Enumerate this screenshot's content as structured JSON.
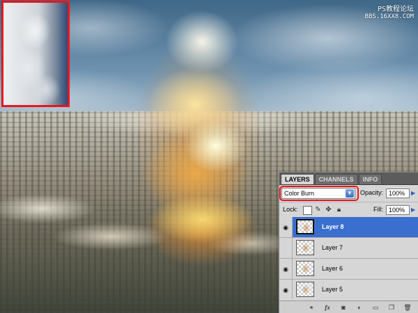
{
  "watermark": {
    "line1": "PS教程论坛",
    "line2": "BBS.16XX8.COM"
  },
  "colors": {
    "highlight": "#e8161c",
    "selection": "#3a6fd0",
    "panel": "#d6d6d6"
  },
  "layers_panel": {
    "tabs": [
      {
        "label": "LAYERS",
        "active": true
      },
      {
        "label": "CHANNELS",
        "active": false
      },
      {
        "label": "INFO",
        "active": false
      }
    ],
    "blend_mode": "Color Burn",
    "opacity_label": "Opacity:",
    "opacity_value": "100%",
    "lock_label": "Lock:",
    "fill_label": "Fill:",
    "fill_value": "100%",
    "layers": [
      {
        "name": "Layer 8",
        "visible": true,
        "selected": true
      },
      {
        "name": "Layer 7",
        "visible": false,
        "selected": false
      },
      {
        "name": "Layer 6",
        "visible": true,
        "selected": false
      },
      {
        "name": "Layer 5",
        "visible": true,
        "selected": false
      }
    ],
    "bottom_icons": [
      "link-icon",
      "fx-icon",
      "mask-icon",
      "adjustment-icon",
      "group-icon",
      "new-layer-icon",
      "trash-icon"
    ]
  }
}
